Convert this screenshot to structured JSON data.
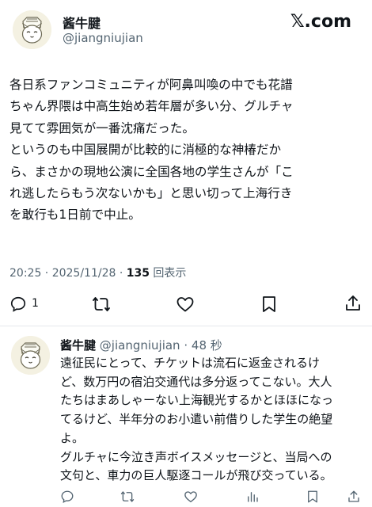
{
  "tweet": {
    "author_name": "酱牛腱",
    "author_handle": "@jiangniujian",
    "brand": "𝕏.com",
    "body": "各日系ファンコミュニティが阿鼻叫喚の中でも花譜\nちゃん界隈は中高生始め若年層が多い分、グルチャ\n見てて雰囲気が一番沈痛だった。\nというのも中国展開が比較的に消極的な神椿だか\nら、まさかの現地公演に全国各地の学生さんが「こ\nれ逃したらもう次ないかも」と思い切って上海行き\nを敢行も1日前で中止。",
    "timestamp": "20:25 · 2025/11/28 · ",
    "views_count": "135",
    "views_label": " 回表示",
    "reply_count": "1"
  },
  "reply": {
    "author_name": "酱牛腱",
    "author_handle": "@jiangniujian",
    "time_ago": "· 48 秒",
    "body": "遠征民にとって、チケットは流石に返金されるけ\nど、数万円の宿泊交通代は多分返ってこない。大人\nたちはまあしゃーない上海観光するかとほほになっ\nてるけど、半年分のお小遣い前借りした学生の絶望\nよ。\nグルチャに今泣き声ボイスメッセージと、当局への\n文句と、車力の巨人駆逐コールが飛び交っている。"
  },
  "icons": {
    "reply": "reply-icon",
    "retweet": "retweet-icon",
    "like": "like-icon",
    "bookmark": "bookmark-icon",
    "share": "share-icon",
    "views": "views-icon"
  },
  "colors": {
    "text": "#0f1419",
    "muted": "#536471",
    "divider": "#e6e9ec"
  }
}
